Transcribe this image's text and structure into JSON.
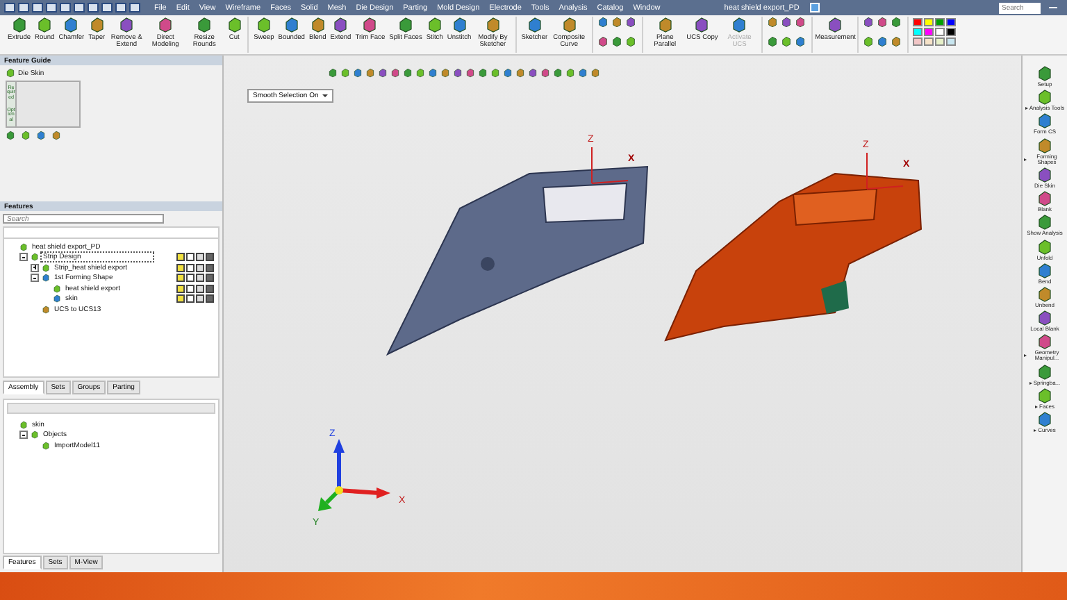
{
  "title_bar": {
    "menu": [
      "File",
      "Edit",
      "View",
      "Wireframe",
      "Faces",
      "Solid",
      "Mesh",
      "Die Design",
      "Parting",
      "Mold Design",
      "Electrode",
      "Tools",
      "Analysis",
      "Catalog",
      "Window"
    ],
    "document_title": "heat shield export_PD",
    "search": {
      "placeholder": "Search"
    }
  },
  "ribbon": {
    "groups": [
      {
        "buttons": [
          {
            "label": "Extrude",
            "disabled": false
          },
          {
            "label": "Round",
            "disabled": false
          },
          {
            "label": "Chamfer",
            "disabled": false
          },
          {
            "label": "Taper",
            "disabled": false
          },
          {
            "label": "Remove & Extend",
            "disabled": false
          },
          {
            "label": "Direct Modeling",
            "disabled": false
          },
          {
            "label": "Resize Rounds",
            "disabled": false
          },
          {
            "label": "Cut",
            "disabled": false
          }
        ]
      },
      {
        "buttons": [
          {
            "label": "Sweep",
            "disabled": false
          },
          {
            "label": "Bounded",
            "disabled": false
          },
          {
            "label": "Blend",
            "disabled": false
          },
          {
            "label": "Extend",
            "disabled": false
          },
          {
            "label": "Trim Face",
            "disabled": false
          },
          {
            "label": "Split Faces",
            "disabled": false
          },
          {
            "label": "Stitch",
            "disabled": false
          },
          {
            "label": "Unstitch",
            "disabled": false
          },
          {
            "label": "Modify By Sketcher",
            "disabled": false
          }
        ]
      },
      {
        "buttons": [
          {
            "label": "Sketcher",
            "disabled": false
          },
          {
            "label": "Composite Curve",
            "disabled": false
          }
        ]
      },
      {
        "buttons": [
          {
            "label": "Plane Parallel",
            "disabled": false
          },
          {
            "label": "UCS Copy",
            "disabled": false
          },
          {
            "label": "Activate UCS",
            "disabled": true
          }
        ]
      },
      {
        "buttons": [
          {
            "label": "Measurement",
            "disabled": false
          }
        ]
      }
    ],
    "swatches": [
      {
        "color": "#ff0000"
      },
      {
        "color": "#ffff00"
      },
      {
        "color": "#00a000"
      },
      {
        "color": "#0000ff"
      },
      {
        "color": "#00ffff"
      },
      {
        "color": "#ff00ff"
      },
      {
        "color": "#ffffff"
      },
      {
        "color": "#000000"
      },
      {
        "color": "#f2c6c6"
      },
      {
        "color": "#f6e2c8"
      },
      {
        "color": "#e6f0c8"
      },
      {
        "color": "#c8e6f0"
      }
    ]
  },
  "feature_guide": {
    "title": "Feature Guide",
    "item": "Die Skin",
    "side_tabs": [
      "Required",
      "Optional"
    ]
  },
  "features": {
    "title": "Features",
    "search": {
      "placeholder": "Search"
    },
    "tree": [
      {
        "label": "heat shield export_PD",
        "selected": false,
        "status_icons": false,
        "children": [
          {
            "label": "Strip Design",
            "selected": true,
            "status_icons": true,
            "expanded": true,
            "children": [
              {
                "label": "Strip_heat shield export",
                "selected": false,
                "status_icons": true,
                "expanded": false
              },
              {
                "label": "1st Forming Shape",
                "selected": false,
                "status_icons": true,
                "expanded": true,
                "children": [
                  {
                    "label": "heat shield export",
                    "selected": false,
                    "status_icons": true
                  },
                  {
                    "label": "skin",
                    "selected": false,
                    "status_icons": true
                  }
                ]
              },
              {
                "label": "UCS to UCS13",
                "selected": false,
                "status_icons": false
              }
            ]
          }
        ]
      }
    ],
    "tabs": [
      {
        "label": "Assembly",
        "selected": true
      },
      {
        "label": "Sets",
        "selected": false
      },
      {
        "label": "Groups",
        "selected": false
      },
      {
        "label": "Parting",
        "selected": false
      }
    ]
  },
  "objects_tree": [
    {
      "label": "skin",
      "selected": false,
      "children": [
        {
          "label": "Objects",
          "selected": false,
          "expanded": true,
          "children": [
            {
              "label": "ImportModel11",
              "selected": false
            }
          ]
        }
      ]
    }
  ],
  "bottom_tabs": [
    {
      "label": "Features",
      "selected": true
    },
    {
      "label": "Sets",
      "selected": false
    },
    {
      "label": "M-View",
      "selected": false
    }
  ],
  "viewport": {
    "selection_dropdown": "Smooth Selection On",
    "part_axes": [
      {
        "z": "Z",
        "x": "X"
      },
      {
        "z": "Z",
        "x": "X"
      }
    ],
    "triad": {
      "z": "Z",
      "x": "X",
      "y": "Y"
    }
  },
  "right_toolbar": [
    {
      "label": "Setup",
      "has_menu": false
    },
    {
      "label": "Analysis Tools",
      "has_menu": true
    },
    {
      "label": "Form CS",
      "has_menu": false
    },
    {
      "label": "Forming Shapes",
      "has_menu": true
    },
    {
      "label": "Die Skin",
      "has_menu": false
    },
    {
      "label": "Blank",
      "has_menu": false
    },
    {
      "label": "Show Analysis",
      "has_menu": false
    },
    {
      "label": "Unfold",
      "has_menu": false
    },
    {
      "label": "Bend",
      "has_menu": false
    },
    {
      "label": "Unbend",
      "has_menu": false
    },
    {
      "label": "Local Blank",
      "has_menu": false
    },
    {
      "label": "Geometry Manipul...",
      "has_menu": true
    },
    {
      "label": "Springba...",
      "has_menu": true
    },
    {
      "label": "Faces",
      "has_menu": true
    },
    {
      "label": "Curves",
      "has_menu": true
    }
  ]
}
